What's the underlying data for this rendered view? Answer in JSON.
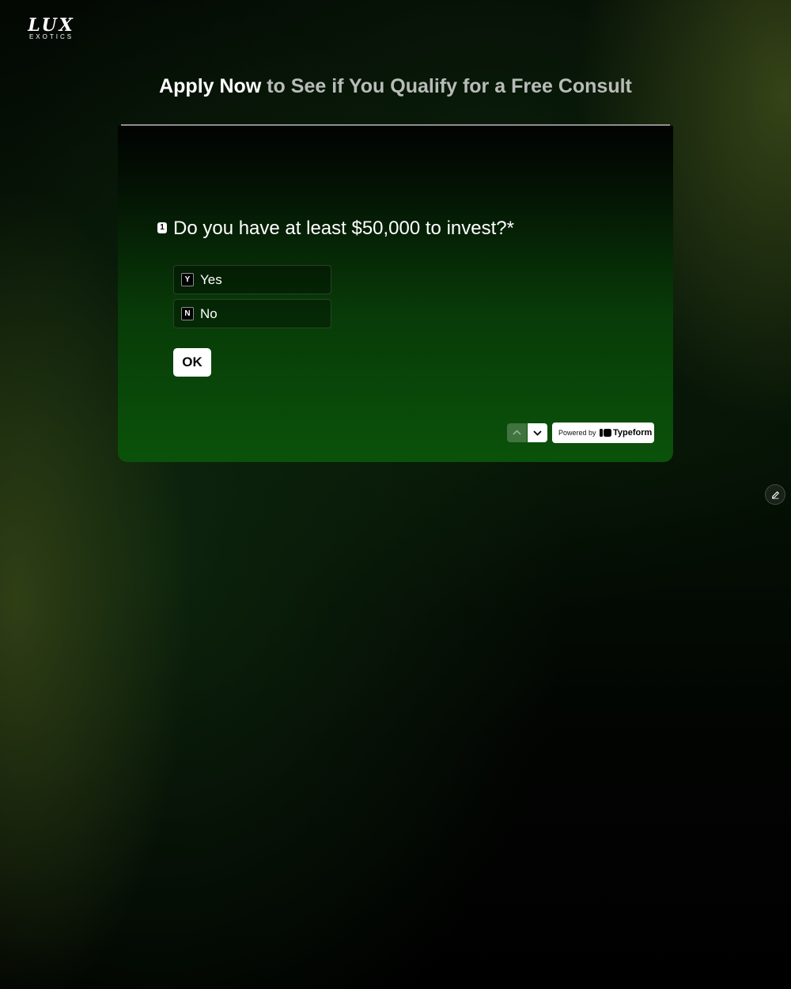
{
  "brand": {
    "name": "LUX",
    "subname": "EXOTICS"
  },
  "headline": {
    "strong": "Apply Now",
    "rest": " to See if You Qualify for a Free Consult"
  },
  "form": {
    "question_number": "1",
    "question": "Do you have at least $50,000 to invest?*",
    "choices": [
      {
        "key": "Y",
        "label": "Yes"
      },
      {
        "key": "N",
        "label": "No"
      }
    ],
    "submit_label": "OK"
  },
  "footer": {
    "powered_by": "Powered by",
    "provider": "Typeform",
    "nav_up_icon": "chevron-up-icon",
    "nav_down_icon": "chevron-down-icon"
  },
  "edit_icon": "pencil-icon"
}
